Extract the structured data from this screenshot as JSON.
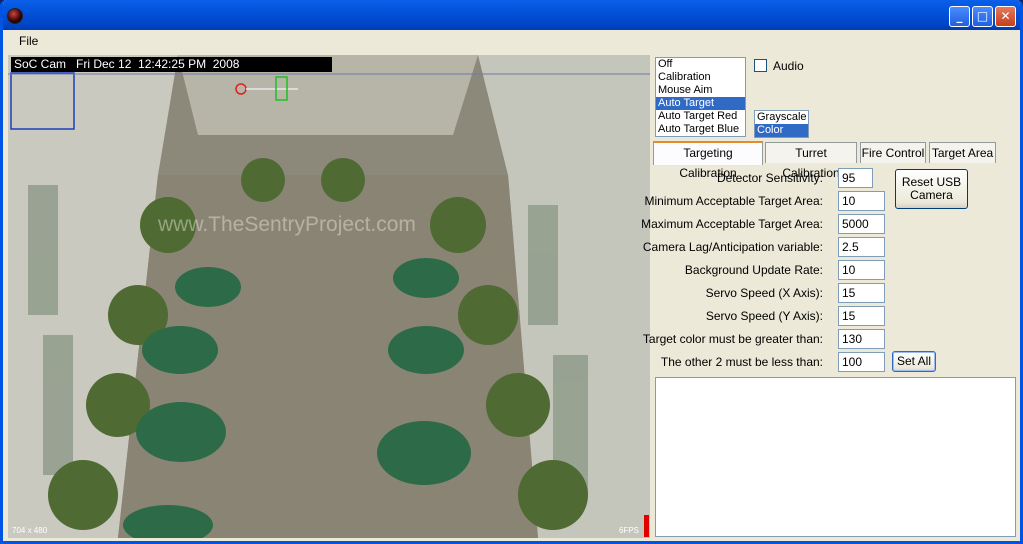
{
  "menu": {
    "file": "File"
  },
  "title_buttons": {
    "minimize": "_",
    "maximize": "□",
    "close": "✕"
  },
  "video": {
    "overlay": "SoC Cam   Fri Dec 12  12:42:25 PM  2008",
    "watermark": "www.TheSentryProject.com",
    "resolution": "704 x 480",
    "fps": "6FPS"
  },
  "mode_list": [
    "Off",
    "Calibration",
    "Mouse Aim",
    "Auto Target",
    "Auto Target Red",
    "Auto Target Blue"
  ],
  "mode_selected": "Auto Target",
  "audio_label": "Audio",
  "color_list": [
    "Grayscale",
    "Color"
  ],
  "color_selected": "Color",
  "tabs": [
    "Targeting Calibration",
    "Turret Calibration",
    "Fire Control",
    "Target Area"
  ],
  "active_tab": "Targeting Calibration",
  "settings": [
    {
      "label": "Detector Sensitivity:",
      "value": "95"
    },
    {
      "label": "Minimum Acceptable Target Area:",
      "value": "10"
    },
    {
      "label": "Maximum Acceptable Target Area:",
      "value": "5000"
    },
    {
      "label": "Camera Lag/Anticipation variable:",
      "value": "2.5"
    },
    {
      "label": "Background Update Rate:",
      "value": "10"
    },
    {
      "label": "Servo Speed (X Axis):",
      "value": "15"
    },
    {
      "label": "Servo Speed (Y Axis):",
      "value": "15"
    },
    {
      "label": "Target color must be greater than:",
      "value": "130"
    },
    {
      "label": "The other 2 must be less than:",
      "value": "100"
    }
  ],
  "buttons": {
    "reset_usb": "Reset USB Camera",
    "set_all": "Set All"
  },
  "colors": {
    "titlebar": "#0250d8",
    "selection": "#316ac5",
    "tab_highlight": "#e68b2c"
  }
}
